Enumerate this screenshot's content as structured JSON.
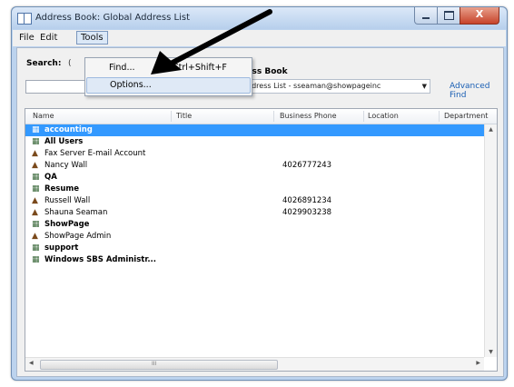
{
  "window": {
    "title": "Address Book: Global Address List",
    "close_glyph": "X"
  },
  "menu": {
    "file": "File",
    "edit": "Edit",
    "tools": "Tools"
  },
  "tools_menu": {
    "find_label": "Find...",
    "find_shortcut": "Ctrl+Shift+F",
    "options_label": "Options..."
  },
  "search": {
    "label": "Search:",
    "radio_stub": "(",
    "value": ""
  },
  "address_book": {
    "label": "ress Book",
    "selected": "al Address List - sseaman@showpageinc",
    "advanced_find": "Advanced Find"
  },
  "columns": [
    "Name",
    "Title",
    "Business Phone",
    "Location",
    "Department"
  ],
  "rows": [
    {
      "name": "accounting",
      "phone": "",
      "type": "group",
      "bold": true,
      "selected": true
    },
    {
      "name": "All Users",
      "phone": "",
      "type": "group",
      "bold": true,
      "selected": false
    },
    {
      "name": "Fax Server E-mail Account",
      "phone": "",
      "type": "user",
      "bold": false,
      "selected": false
    },
    {
      "name": "Nancy Wall",
      "phone": "4026777243",
      "type": "user",
      "bold": false,
      "selected": false
    },
    {
      "name": "QA",
      "phone": "",
      "type": "group",
      "bold": true,
      "selected": false
    },
    {
      "name": "Resume",
      "phone": "",
      "type": "group",
      "bold": true,
      "selected": false
    },
    {
      "name": "Russell Wall",
      "phone": "4026891234",
      "type": "user",
      "bold": false,
      "selected": false
    },
    {
      "name": "Shauna Seaman",
      "phone": "4029903238",
      "type": "user",
      "bold": false,
      "selected": false
    },
    {
      "name": "ShowPage",
      "phone": "",
      "type": "group",
      "bold": true,
      "selected": false
    },
    {
      "name": "ShowPage Admin",
      "phone": "",
      "type": "user",
      "bold": false,
      "selected": false
    },
    {
      "name": "support",
      "phone": "",
      "type": "group",
      "bold": true,
      "selected": false
    },
    {
      "name": "Windows SBS Administr...",
      "phone": "",
      "type": "group",
      "bold": true,
      "selected": false
    }
  ],
  "scrollbar": {
    "grip": "III"
  }
}
